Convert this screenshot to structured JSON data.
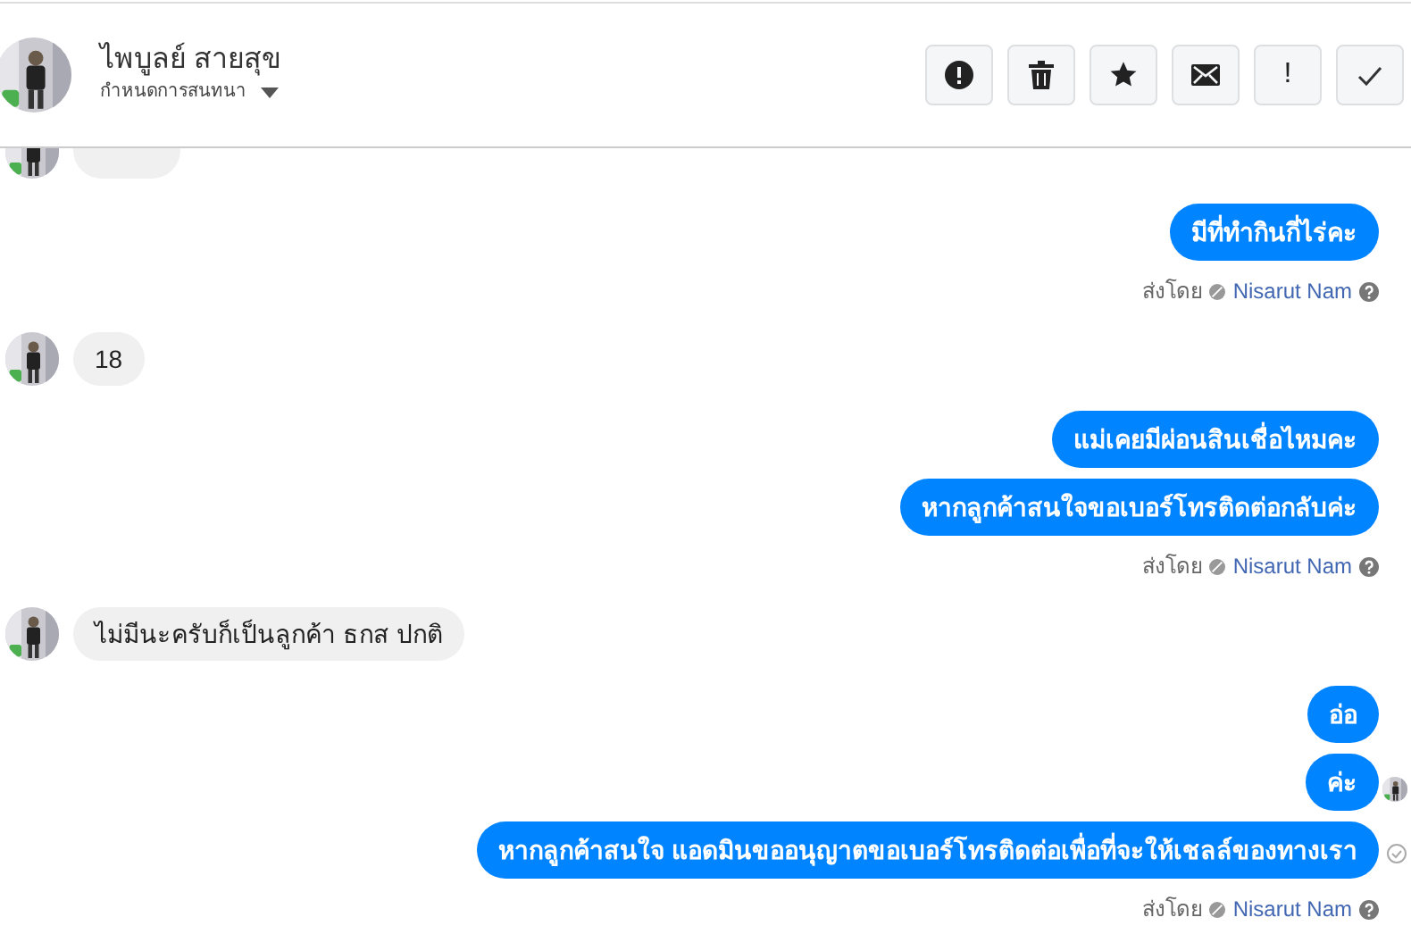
{
  "header": {
    "name": "ไพบูลย์ สายสุข",
    "subtitle": "กำหนดการสนทนา",
    "actions": [
      {
        "kind": "alert"
      },
      {
        "kind": "trash"
      },
      {
        "kind": "star"
      },
      {
        "kind": "mail"
      },
      {
        "kind": "exclaim",
        "label": "!"
      },
      {
        "kind": "check"
      }
    ]
  },
  "thread": [
    {
      "kind": "incoming_cut"
    },
    {
      "kind": "outgoing",
      "text": "มีที่ทำกินกี่ไร่คะ"
    },
    {
      "kind": "sent_by",
      "label": "ส่งโดย",
      "sender": "Nisarut Nam"
    },
    {
      "kind": "incoming",
      "text": "18"
    },
    {
      "kind": "outgoing",
      "text": "แม่เคยมีผ่อนสินเชื่อไหมคะ"
    },
    {
      "kind": "outgoing",
      "text": "หากลูกค้าสนใจขอเบอร์โทรติดต่อกลับค่ะ"
    },
    {
      "kind": "sent_by",
      "label": "ส่งโดย",
      "sender": "Nisarut Nam"
    },
    {
      "kind": "incoming",
      "text": "ไม่มีนะครับก็เป็นลูกค้า ธกส ปกติ"
    },
    {
      "kind": "outgoing",
      "text": "อ่อ"
    },
    {
      "kind": "outgoing",
      "text": "ค่ะ",
      "seen": true
    },
    {
      "kind": "outgoing",
      "text": "หากลูกค้าสนใจ แอดมินขออนุญาตขอเบอร์โทรติดต่อเพื่อที่จะให้เชลล์ของทางเรา",
      "delivered": true
    },
    {
      "kind": "sent_by",
      "label": "ส่งโดย",
      "sender": "Nisarut Nam"
    }
  ]
}
